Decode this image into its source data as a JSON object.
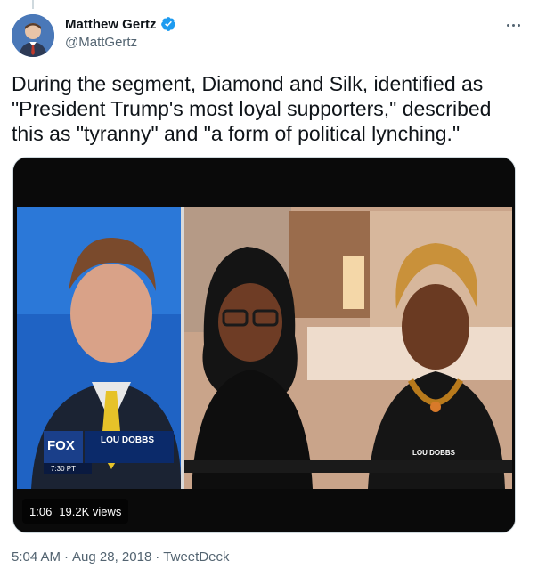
{
  "author": {
    "display_name": "Matthew Gertz",
    "handle": "@MattGertz"
  },
  "icons": {
    "verified": "verified-badge-icon",
    "more": "more-options-icon"
  },
  "colors": {
    "verified": "#1d9bf0",
    "secondary_text": "#536471"
  },
  "tweet": {
    "text": "During the segment, Diamond and Silk, identified as \"President Trump's most loyal supporters,\" described this as \"tyranny\" and \"a form of political lynching.\""
  },
  "video": {
    "duration": "1:06",
    "views": "19.2K views",
    "lower_third_brand": "FOX",
    "lower_third_show": "LOU DOBBS",
    "lower_third_tag": "LOU DOBBS",
    "lower_third_time": "7:30 PT"
  },
  "meta": {
    "time": "5:04 AM",
    "separator1": "·",
    "date": "Aug 28, 2018",
    "separator2": "·",
    "source": "TweetDeck"
  }
}
